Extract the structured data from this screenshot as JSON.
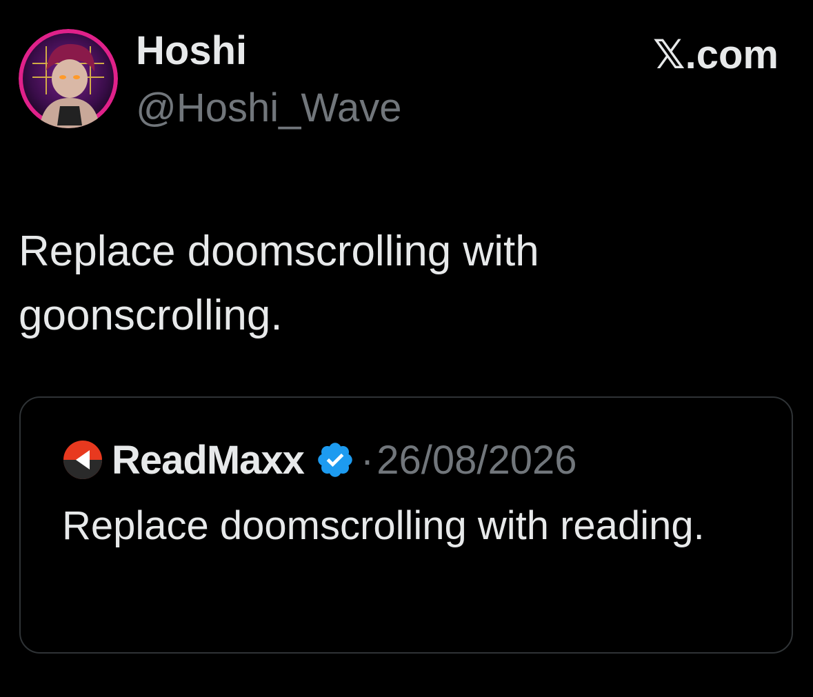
{
  "author": {
    "display_name": "Hoshi",
    "handle": "@Hoshi_Wave"
  },
  "brand": {
    "label": "𝕏.com"
  },
  "tweet": {
    "text": "Replace doomscrolling with goonscrolling."
  },
  "quoted_tweet": {
    "author_name": "ReadMaxx",
    "separator": "·",
    "date": "26/08/2026",
    "text": "Replace doomscrolling with reading.",
    "verified_icon": "verified-badge-icon",
    "logo_icon": "readmaxx-logo-icon"
  },
  "colors": {
    "background": "#000000",
    "text_primary": "#e7e9ea",
    "text_secondary": "#71767b",
    "border": "#2f3336",
    "verified_blue": "#1d9bf0",
    "avatar_ring": "#e0218a",
    "readmaxx_red": "#e8391f"
  }
}
